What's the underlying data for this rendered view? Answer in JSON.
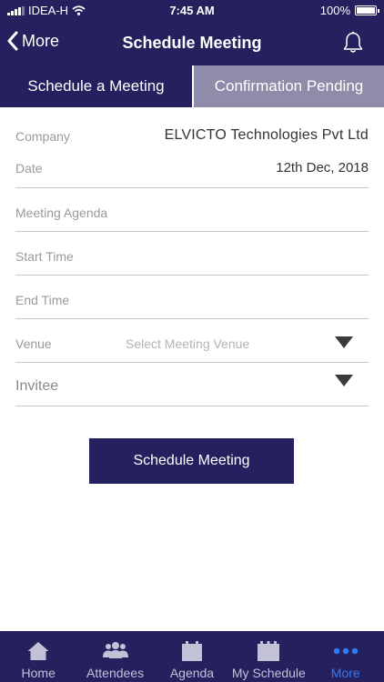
{
  "status_bar": {
    "carrier": "IDEA-H",
    "time": "7:45 AM",
    "battery": "100%"
  },
  "nav": {
    "back_label": "More",
    "title": "Schedule Meeting"
  },
  "tabs": [
    {
      "label": "Schedule a Meeting",
      "active": true
    },
    {
      "label": "Confirmation Pending",
      "active": false
    }
  ],
  "form": {
    "company": {
      "label": "Company",
      "value": "ELVICTO Technologies Pvt Ltd"
    },
    "date": {
      "label": "Date",
      "value": "12th Dec, 2018"
    },
    "agenda": {
      "placeholder": "Meeting Agenda"
    },
    "start_time": {
      "placeholder": "Start Time"
    },
    "end_time": {
      "placeholder": "End Time"
    },
    "venue": {
      "label": "Venue",
      "placeholder": "Select Meeting Venue"
    },
    "invitee": {
      "placeholder": "Invitee"
    },
    "submit_label": "Schedule Meeting"
  },
  "tabbar": {
    "items": [
      {
        "label": "Home",
        "icon": "home-icon",
        "active": false
      },
      {
        "label": "Attendees",
        "icon": "attendees-icon",
        "active": false
      },
      {
        "label": "Agenda",
        "icon": "agenda-icon",
        "active": false
      },
      {
        "label": "My Schedule",
        "icon": "calendar-icon",
        "active": false
      },
      {
        "label": "More",
        "icon": "more-dots-icon",
        "active": true
      }
    ]
  },
  "colors": {
    "primary": "#25205e",
    "inactive_tab": "#8e8ca8",
    "active_tabbar_item": "#2f7bf5",
    "label_gray": "#9a9a9a"
  }
}
